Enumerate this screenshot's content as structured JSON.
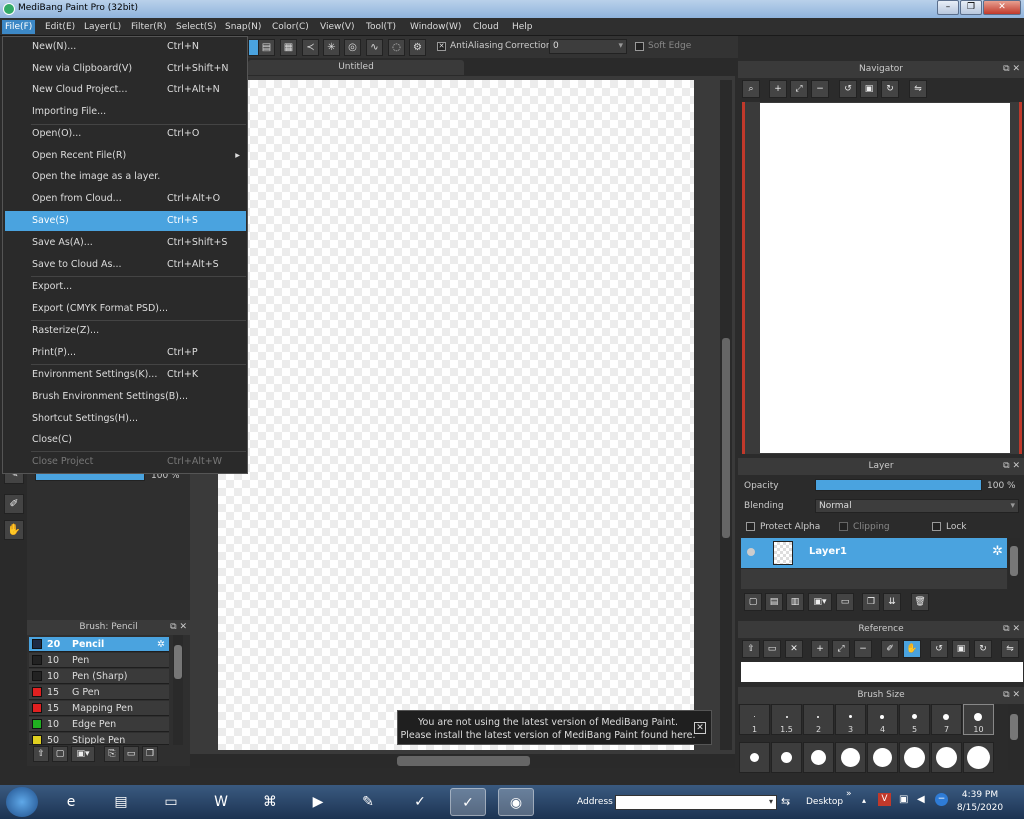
{
  "window": {
    "title": "MediBang Paint Pro (32bit)"
  },
  "menubar": [
    {
      "label": "File(F)"
    },
    {
      "label": "Edit(E)"
    },
    {
      "label": "Layer(L)"
    },
    {
      "label": "Filter(R)"
    },
    {
      "label": "Select(S)"
    },
    {
      "label": "Snap(N)"
    },
    {
      "label": "Color(C)"
    },
    {
      "label": "View(V)"
    },
    {
      "label": "Tool(T)"
    },
    {
      "label": "Window(W)"
    },
    {
      "label": "Cloud"
    },
    {
      "label": "Help"
    }
  ],
  "toolbar": {
    "antialiasing_label": "AntiAliasing",
    "correction_label": "Correction",
    "correction_value": "0",
    "softedge_label": "Soft Edge"
  },
  "document": {
    "tab_title": "Untitled"
  },
  "file_menu": [
    {
      "label": "New(N)...",
      "shortcut": "Ctrl+N"
    },
    {
      "label": "New via Clipboard(V)",
      "shortcut": "Ctrl+Shift+N"
    },
    {
      "label": "New Cloud Project...",
      "shortcut": "Ctrl+Alt+N"
    },
    {
      "label": "Importing File...",
      "shortcut": ""
    },
    {
      "label": "Open(O)...",
      "shortcut": "Ctrl+O"
    },
    {
      "label": "Open Recent File(R)",
      "shortcut": ""
    },
    {
      "label": "Open the image as a layer.",
      "shortcut": ""
    },
    {
      "label": "Open from Cloud...",
      "shortcut": "Ctrl+Alt+O"
    },
    {
      "label": "Save(S)",
      "shortcut": "Ctrl+S"
    },
    {
      "label": "Save As(A)...",
      "shortcut": "Ctrl+Shift+S"
    },
    {
      "label": "Save to Cloud As...",
      "shortcut": "Ctrl+Alt+S"
    },
    {
      "label": "Export...",
      "shortcut": ""
    },
    {
      "label": "Export (CMYK Format PSD)...",
      "shortcut": ""
    },
    {
      "label": "Rasterize(Z)...",
      "shortcut": ""
    },
    {
      "label": "Print(P)...",
      "shortcut": "Ctrl+P"
    },
    {
      "label": "Environment Settings(K)...",
      "shortcut": "Ctrl+K"
    },
    {
      "label": "Brush Environment Settings(B)...",
      "shortcut": ""
    },
    {
      "label": "Shortcut Settings(H)...",
      "shortcut": ""
    },
    {
      "label": "Close(C)",
      "shortcut": ""
    },
    {
      "label": "Close Project",
      "shortcut": "Ctrl+Alt+W"
    }
  ],
  "left_slider": {
    "value_label": "100 %",
    "level": 1.0
  },
  "brush_panel": {
    "title": "Brush: Pencil",
    "items": [
      {
        "size": "20",
        "name": "Pencil",
        "color": "#1e2a44"
      },
      {
        "size": "10",
        "name": "Pen",
        "color": "#222222"
      },
      {
        "size": "10",
        "name": "Pen (Sharp)",
        "color": "#222222"
      },
      {
        "size": "15",
        "name": "G Pen",
        "color": "#e02020"
      },
      {
        "size": "15",
        "name": "Mapping Pen",
        "color": "#e02020"
      },
      {
        "size": "10",
        "name": "Edge Pen",
        "color": "#20b020"
      },
      {
        "size": "50",
        "name": "Stipple Pen",
        "color": "#e0d020"
      }
    ]
  },
  "notice": {
    "line1": "You are not using the latest version of MediBang Paint.",
    "line2": "Please install the latest version of MediBang Paint found here."
  },
  "navigator": {
    "title": "Navigator"
  },
  "layer_panel": {
    "title": "Layer",
    "opacity_label": "Opacity",
    "opacity_value": "100 %",
    "opacity_level": 1.0,
    "blending_label": "Blending",
    "blending_value": "Normal",
    "protect_alpha": "Protect Alpha",
    "clipping": "Clipping",
    "lock": "Lock",
    "layer_name": "Layer1"
  },
  "reference": {
    "title": "Reference"
  },
  "brush_size": {
    "title": "Brush Size",
    "sizes": [
      "1",
      "1.5",
      "2",
      "3",
      "4",
      "5",
      "7",
      "10"
    ]
  },
  "taskbar": {
    "address_label": "Address",
    "desktop_label": "Desktop",
    "time": "4:39 PM",
    "date": "8/15/2020"
  },
  "colors": {
    "accent": "#4aa3df",
    "menu_bg": "#2a2a2a",
    "nav_border": "#c0392b"
  }
}
